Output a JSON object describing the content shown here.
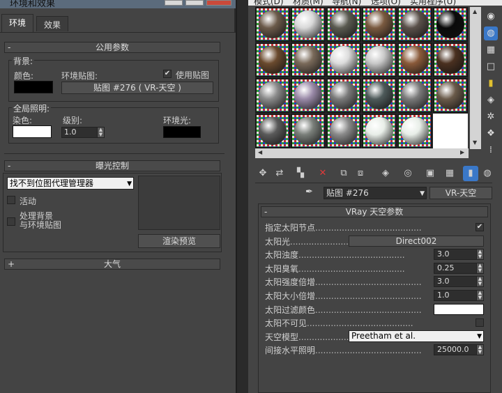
{
  "left_window": {
    "title": "环境和效果",
    "tabs": [
      "环境",
      "效果"
    ],
    "common": {
      "header": "公用参数",
      "background_group": "背景:",
      "color_label": "颜色:",
      "env_map_label": "环境贴图:",
      "use_map_label": "使用贴图",
      "use_map_checked": "✔",
      "map_button": "贴图 #276 ( VR-天空 )",
      "global_light_group": "全局照明:",
      "tint_label": "染色:",
      "level_label": "级别:",
      "ambient_label": "环境光:",
      "level_value": "1.0",
      "color_swatch": "#000000",
      "tint_swatch": "#ffffff",
      "ambient_swatch": "#000000"
    },
    "exposure": {
      "header": "曝光控制",
      "dropdown_value": "找不到位图代理管理器",
      "active_label": "活动",
      "process_bg_line1": "处理背景",
      "process_bg_line2": "与环境贴图",
      "render_preview": "渲染预览"
    },
    "atmosphere": {
      "header": "大气",
      "toggle": "+"
    },
    "minus": "-"
  },
  "right_window": {
    "menu": [
      "模式(D)",
      "材质(M)",
      "导航(N)",
      "选项(O)",
      "实用程序(U)"
    ],
    "map_name": "贴图 #276",
    "map_type": "VR-天空",
    "vray_header": "VRay 天空参数",
    "params": [
      {
        "label": "指定太阳节点",
        "kind": "check",
        "value": "✔"
      },
      {
        "label": "太阳光",
        "kind": "button",
        "value": "Direct002"
      },
      {
        "label": "太阳浊度",
        "kind": "spinner",
        "value": "3.0"
      },
      {
        "label": "太阳臭氧",
        "kind": "spinner",
        "value": "0.25"
      },
      {
        "label": "太阳强度倍增",
        "kind": "spinner",
        "value": "3.0"
      },
      {
        "label": "太阳大小倍增",
        "kind": "spinner",
        "value": "1.0"
      },
      {
        "label": "太阳过滤颜色",
        "kind": "color",
        "value": "#ffffff"
      },
      {
        "label": "太阳不可见",
        "kind": "check",
        "value": ""
      },
      {
        "label": "天空模型",
        "kind": "select",
        "value": "Preetham et al."
      },
      {
        "label": "间接水平照明",
        "kind": "spinner",
        "value": "25000.0"
      }
    ],
    "slot_colors": [
      [
        "#6b5a4a",
        "#d8d8d8",
        "#5a5a50",
        "#7a5a40",
        "#5a504a",
        "#0a0a0a"
      ],
      [
        "#6a4a2e",
        "#7a6a5a",
        "#dcdcdc",
        "#c8c8c8",
        "#8a5a3a",
        "#4a3020"
      ],
      [
        "#8a8a8a",
        "#9a8aa8",
        "#7a7a7a",
        "#4e5a5a",
        "#7a7a7a",
        "#6a5a4a"
      ],
      [
        "#5a5a5a",
        "#7a7f7a",
        "#8a8a8a",
        "#e8eee8",
        "#e8eee8",
        "#ffffff"
      ]
    ]
  }
}
